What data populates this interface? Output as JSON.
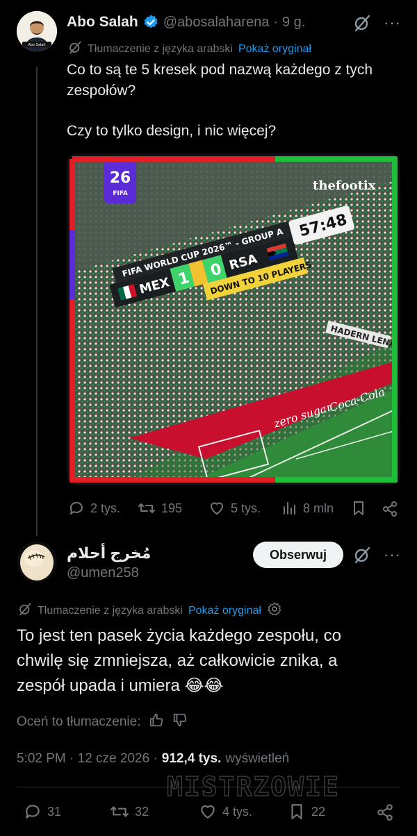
{
  "tweet": {
    "author_name": "Abo Salah",
    "handle": "@abosalaharena",
    "separator": "·",
    "time": "9 g.",
    "avatar_caption": "Abo Salah",
    "translated_from": "Tłumaczenie z języka arabski",
    "show_original": "Pokaż oryginał",
    "text_line1": "Co to są te 5 kresek pod nazwą każdego z tych",
    "text_line2": "zespołów?",
    "text_line3": "Czy to tylko design, i nic więcej?",
    "media": {
      "channel_logo": "thefootix",
      "banner_title": "FIFA WORLD CUP 2026™ - GROUP A",
      "team_home": "MEX",
      "score_home": "1",
      "score_away": "0",
      "team_away": "RSA",
      "clock": "57:48",
      "alert": "DOWN TO 10 PLAYERS",
      "board_text": "HADERN LENA",
      "ad_text_1": "zero sugar",
      "ad_text_2": "Coca-Cola",
      "badge_year": "26",
      "badge_label": "FIFA",
      "frame_colors": [
        "#e21f26",
        "#5a2bd6",
        "#1fbe3a"
      ]
    },
    "actions": {
      "replies": "2 tys.",
      "reposts": "195",
      "likes": "5 tys.",
      "views": "8 mln"
    }
  },
  "reply": {
    "author_name": "مُخرج أحلام",
    "handle": "@umen258",
    "follow_label": "Obserwuj",
    "translated_from": "Tłumaczenie z języka arabski",
    "show_original": "Pokaż oryginał",
    "text_line1": "To jest ten pasek życia każdego zespołu, co",
    "text_line2": "chwilę się zmniejsza, aż całkowicie znika, a",
    "text_line3": "zespół upada i umiera",
    "emoji": "😂😂",
    "rate_translation": "Oceń to tłumaczenie:",
    "timestamp": "5:02 PM · 12 cze 2026 ·",
    "views_count": "912,4 tys.",
    "views_label": "wyświetleń",
    "actions": {
      "replies": "31",
      "reposts": "32",
      "likes": "4 tys.",
      "bookmarks": "22"
    }
  },
  "watermark": "MISTRZOWIE",
  "colors": {
    "background": "#000000",
    "text": "#e7e9ea",
    "muted": "#71767b",
    "link": "#1d9bf0",
    "verified": "#1d9bf0"
  }
}
